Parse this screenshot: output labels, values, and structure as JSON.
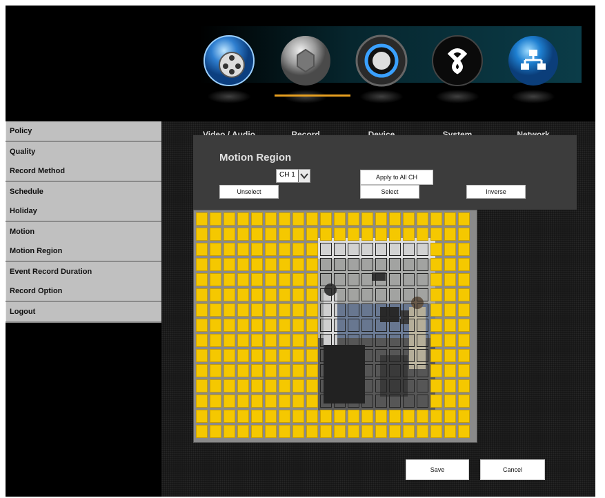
{
  "nav": {
    "items": [
      {
        "label": "Video / Audio",
        "icon": "film-reel-icon"
      },
      {
        "label": "Record",
        "icon": "record-lens-icon"
      },
      {
        "label": "Device",
        "icon": "device-power-icon"
      },
      {
        "label": "System",
        "icon": "system-swirl-icon"
      },
      {
        "label": "Network",
        "icon": "network-tree-icon"
      }
    ],
    "active": "Record",
    "accent_color": "#e8a020"
  },
  "sidebar": {
    "groups": [
      [
        "Policy"
      ],
      [
        "Quality",
        "Record Method"
      ],
      [
        "Schedule",
        "Holiday"
      ],
      [
        "Motion",
        "Motion Region"
      ],
      [
        "Event Record Duration",
        "Record Option"
      ],
      [
        "Logout"
      ]
    ]
  },
  "panel": {
    "title": "Motion Region",
    "channel_value": "CH 1",
    "apply_all_label": "Apply to All CH",
    "unselect_label": "Unselect",
    "select_label": "Select",
    "inverse_label": "Inverse"
  },
  "grid": {
    "columns": 20,
    "rows": 15,
    "selected_color": "#f5c800",
    "unselected_region": {
      "row_start": 2,
      "row_end": 12,
      "col_start": 9,
      "col_end": 16
    }
  },
  "footer": {
    "save_label": "Save",
    "cancel_label": "Cancel"
  }
}
